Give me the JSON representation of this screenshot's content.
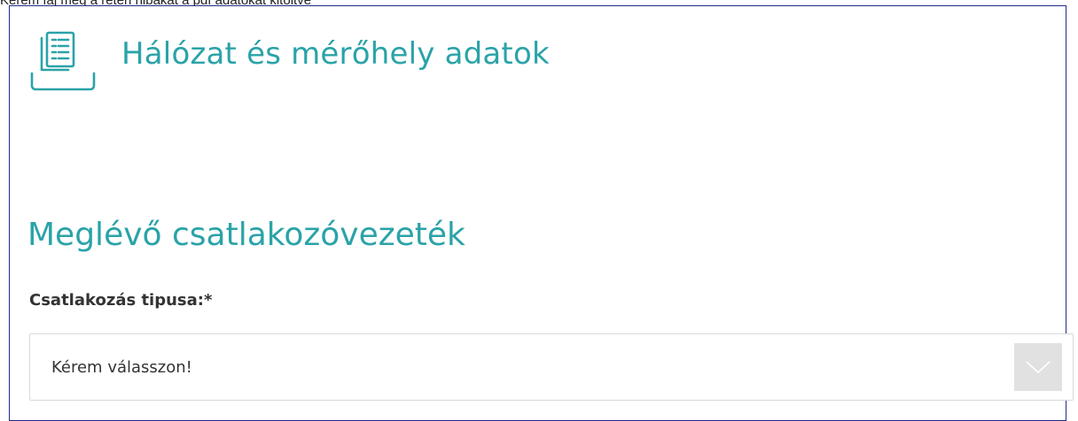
{
  "header": {
    "cut_off_text": "Kérem fáj meg a reten hibakat a pdf adatokat kitoltve",
    "section_title": "Hálózat és mérőhely adatok",
    "section_icon": "document-list-icon"
  },
  "form": {
    "subsection_title": "Meglévő csatlakozóvezeték",
    "connection_type": {
      "label": "Csatlakozás tipusa:*",
      "value": "Kérem válasszon!",
      "arrow_icon": "chevron-down-icon"
    }
  },
  "colors": {
    "accent": "#2aa3a8",
    "frame_border": "#1f2a8a",
    "select_arrow_bg": "#e1e1e1"
  }
}
